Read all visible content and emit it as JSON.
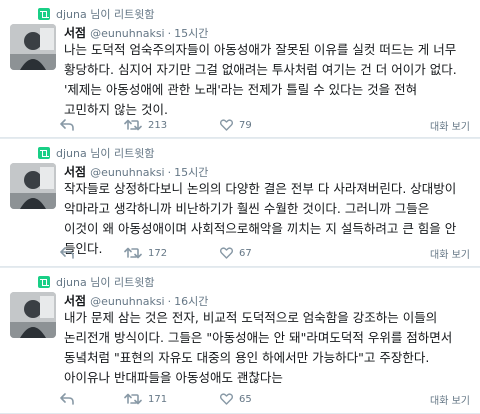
{
  "tweets": [
    {
      "retweeted_by": "djuna 님이 리트윗함",
      "name": "서점",
      "handle": "@eunuhnaksi",
      "dot": "·",
      "time": "15시간",
      "text": "나는 도덕적 엄숙주의자들이 아동성애가 잘못된 이유를 실컷 떠드는 게 너무 황당하다. 심지어 자기만 그걸 없애려는 투사처럼 여기는 건 더 어이가 없다. '제제는 아동성애에 관한 노래'라는 전제가 틀릴 수 있다는 것을 전혀 고민하지 않는 것이.",
      "retweets": "213",
      "likes": "79",
      "conversation": "대화 보기"
    },
    {
      "retweeted_by": "djuna 님이 리트윗함",
      "name": "서점",
      "handle": "@eunuhnaksi",
      "dot": "·",
      "time": "15시간",
      "text": "작자들로 상정하다보니 논의의 다양한 결은 전부 다 사라져버린다. 상대방이 악마라고 생각하니까 비난하기가 훨씬 수월한 것이다. 그러니까 그들은 이것이 왜 아동성애이며 사회적으로해악을 끼치는 지 설득하려고 큰 힘을 안 들인다.",
      "retweets": "172",
      "likes": "67",
      "conversation": "대화 보기"
    },
    {
      "retweeted_by": "djuna 님이 리트윗함",
      "name": "서점",
      "handle": "@eunuhnaksi",
      "dot": "·",
      "time": "16시간",
      "text": "내가 문제 삼는 것은 전자, 비교적 도덕적으로 엄숙함을 강조하는 이들의 논리전개 방식이다. 그들은 \"아동성애는 안 돼\"라며도덕적 우위를 점하면서 동녘처럼 \"표현의 자유도 대중의 용인 하에서만 가능하다\"고 주장한다. 아이유나 반대파들을 아동성애도 괜찮다는",
      "retweets": "171",
      "likes": "65",
      "conversation": "대화 보기"
    }
  ]
}
